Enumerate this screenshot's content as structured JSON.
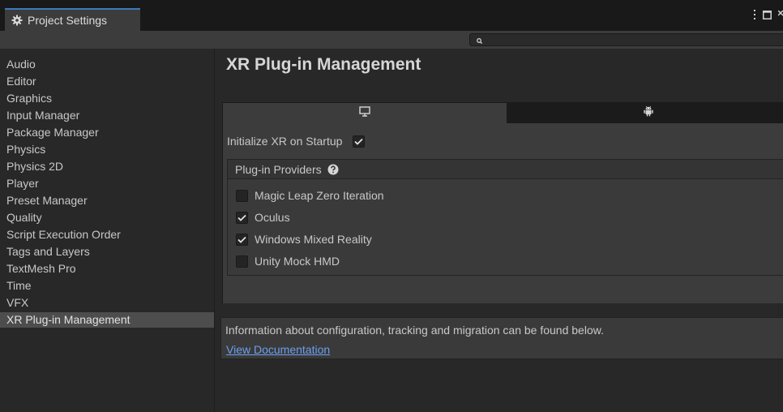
{
  "window": {
    "tab_title": "Project Settings",
    "tab_icon": "gear-icon"
  },
  "search": {
    "value": "",
    "placeholder": ""
  },
  "sidebar": {
    "items": [
      {
        "label": "Audio"
      },
      {
        "label": "Editor"
      },
      {
        "label": "Graphics"
      },
      {
        "label": "Input Manager"
      },
      {
        "label": "Package Manager"
      },
      {
        "label": "Physics"
      },
      {
        "label": "Physics 2D"
      },
      {
        "label": "Player"
      },
      {
        "label": "Preset Manager"
      },
      {
        "label": "Quality"
      },
      {
        "label": "Script Execution Order"
      },
      {
        "label": "Tags and Layers"
      },
      {
        "label": "TextMesh Pro"
      },
      {
        "label": "Time"
      },
      {
        "label": "VFX"
      },
      {
        "label": "XR Plug-in Management",
        "selected": true
      }
    ]
  },
  "main": {
    "title": "XR Plug-in Management",
    "platform_tabs": [
      {
        "icon": "desktop-icon",
        "selected": true
      },
      {
        "icon": "android-icon",
        "selected": false
      }
    ],
    "initialize_label": "Initialize XR on Startup",
    "initialize_checked": true,
    "providers_title": "Plug-in Providers",
    "providers": [
      {
        "label": "Magic Leap Zero Iteration",
        "checked": false
      },
      {
        "label": "Oculus",
        "checked": true
      },
      {
        "label": "Windows Mixed Reality",
        "checked": true
      },
      {
        "label": "Unity Mock HMD",
        "checked": false
      }
    ],
    "info_text": "Information about configuration, tracking and migration can be found below.",
    "doc_link": "View Documentation"
  },
  "colors": {
    "accent_tab": "#3a79bb",
    "link": "#6c9ff0",
    "selection": "#4d4d4d"
  }
}
